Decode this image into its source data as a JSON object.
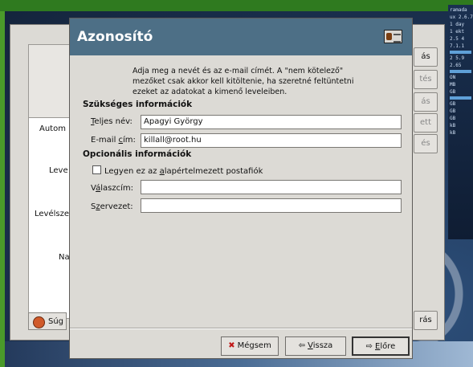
{
  "dialog": {
    "title": "Azonosító",
    "intro": "Adja meg a nevét és az e-mail címét. A \"nem kötelező\" mezőket csak akkor kell kitöltenie, ha szeretné feltüntetni ezeket az adatokat a kimenő leveleiben.",
    "required_section": "Szükséges információk",
    "optional_section": "Opcionális információk",
    "fields": {
      "full_name_label_pre": "",
      "full_name_label_ul": "T",
      "full_name_label_post": "eljes név:",
      "full_name_value": "Apagyi György",
      "email_label_pre": "E-mail ",
      "email_label_ul": "c",
      "email_label_post": "ím:",
      "email_value": "killall@root.hu",
      "default_account_pre": "Legyen ez az ",
      "default_account_ul": "a",
      "default_account_post": "lapértelmezett postafiók",
      "reply_to_pre": "V",
      "reply_to_ul": "á",
      "reply_to_post": "laszcím:",
      "reply_to_value": "",
      "org_pre": "S",
      "org_ul": "z",
      "org_post": "ervezet:",
      "org_value": ""
    },
    "buttons": {
      "cancel": "Mégsem",
      "back_pre": "",
      "back_ul": "V",
      "back_post": "issza",
      "forward_pre": "",
      "forward_ul": "E",
      "forward_post": "lőre"
    }
  },
  "background_window": {
    "labels": {
      "auto": "Autom",
      "lev": "Leve",
      "levelsz": "Levélsze",
      "napt": "Napt"
    },
    "buttons": {
      "b1": "ás",
      "b2": "tés",
      "b3": "ás",
      "b4": "ett",
      "b5": "és",
      "bottom_right": "rás",
      "help": "Súg"
    }
  },
  "monitor": {
    "lines": [
      "ramada",
      "ux 2.6.7",
      "1 day",
      "1 ekt",
      "2.5 4",
      "7.1.1",
      "2 5.9",
      "2.65",
      "ON",
      "MB",
      "GB",
      "GB",
      "GB",
      "GB",
      "kB",
      "kB"
    ]
  },
  "colors": {
    "header_bg": "#4d6f86",
    "dialog_bg": "#dcdad5",
    "cancel_icon": "#c01818"
  }
}
